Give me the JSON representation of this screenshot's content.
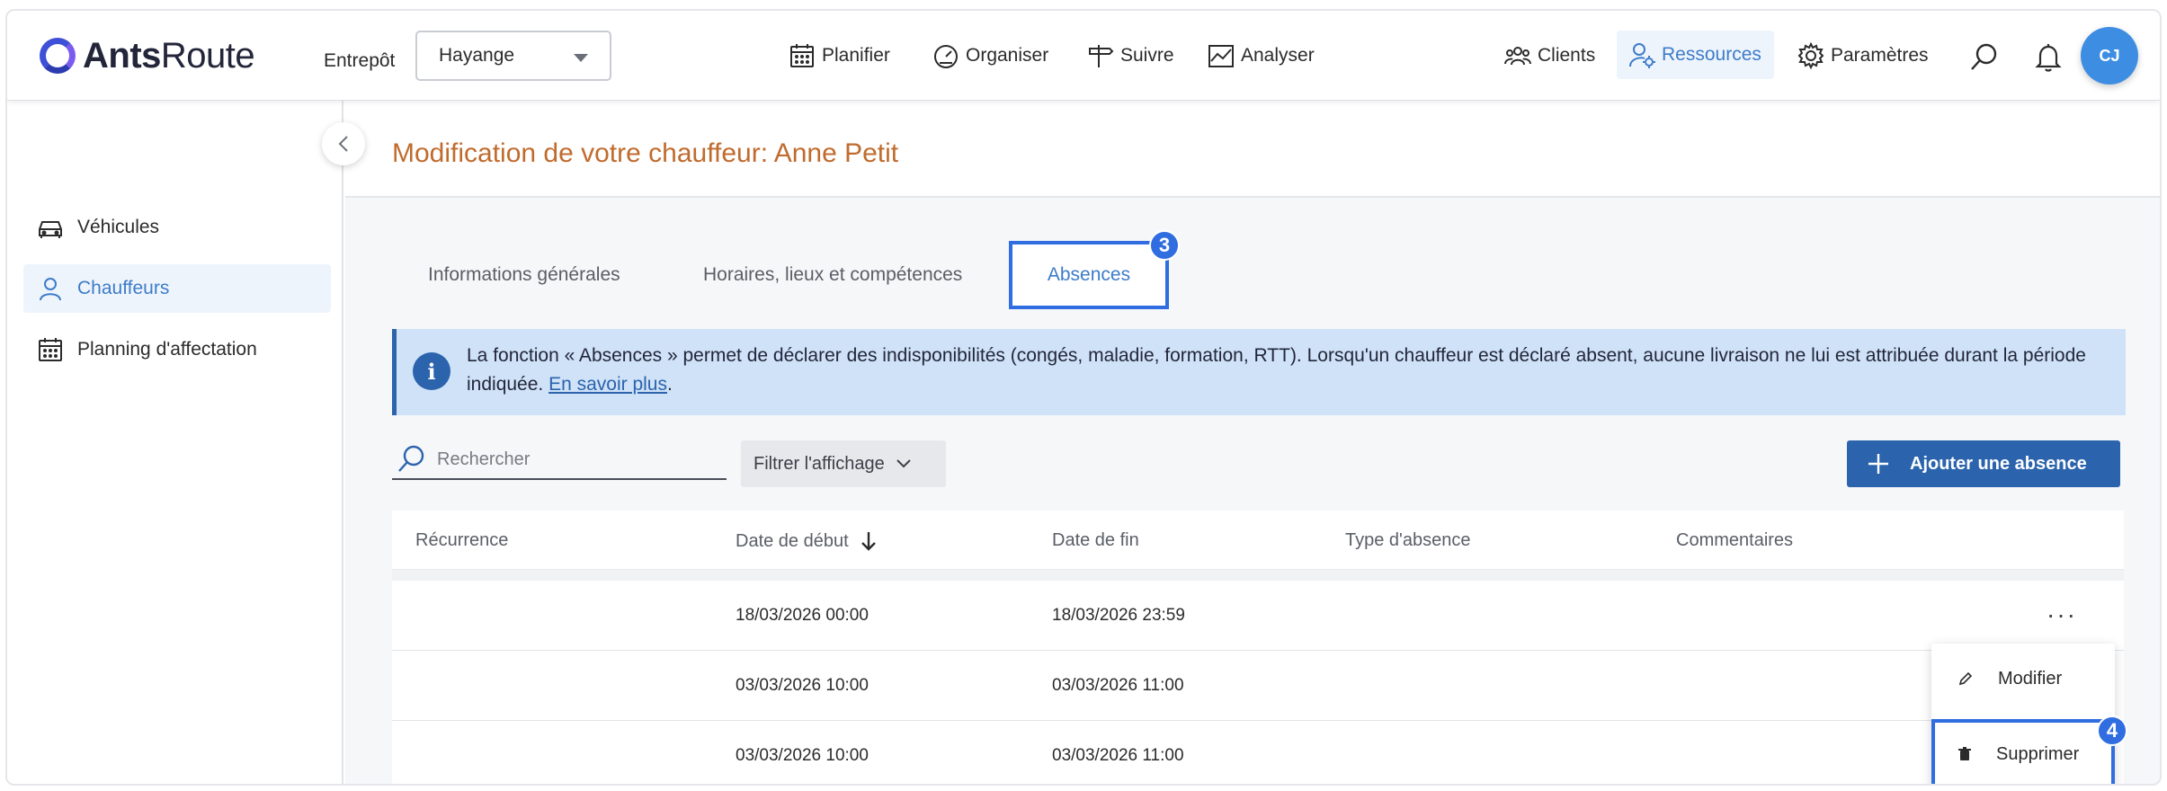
{
  "app": {
    "logo_bold": "Ants",
    "logo_light": "Route"
  },
  "header": {
    "entrepot_label": "Entrepôt",
    "entrepot_value": "Hayange",
    "nav": {
      "planifier": "Planifier",
      "organiser": "Organiser",
      "suivre": "Suivre",
      "analyser": "Analyser",
      "clients": "Clients",
      "ressources": "Ressources",
      "parametres": "Paramètres"
    },
    "avatar_initials": "CJ"
  },
  "sidebar": {
    "items": [
      {
        "label": "Véhicules"
      },
      {
        "label": "Chauffeurs"
      },
      {
        "label": "Planning d'affectation"
      }
    ]
  },
  "page": {
    "title": "Modification de votre chauffeur: Anne Petit"
  },
  "tabs": [
    {
      "label": "Informations générales"
    },
    {
      "label": "Horaires, lieux et compétences"
    },
    {
      "label": "Absences"
    }
  ],
  "step_badges": {
    "tab": "3",
    "delete": "4"
  },
  "info": {
    "icon": "i",
    "text": "La fonction « Absences » permet de déclarer des indisponibilités (congés, maladie, formation, RTT). Lorsqu'un chauffeur est déclaré absent, aucune livraison ne lui est attribuée durant la période indiquée. ",
    "link": "En savoir plus",
    "end": "."
  },
  "toolbar": {
    "search_placeholder": "Rechercher",
    "filter_label": "Filtrer l'affichage",
    "add_label": "Ajouter une absence"
  },
  "table": {
    "columns": [
      "Récurrence",
      "Date de début",
      "Date de fin",
      "Type d'absence",
      "Commentaires"
    ],
    "rows": [
      {
        "recurrence": "",
        "start": "18/03/2026 00:00",
        "end": "18/03/2026 23:59",
        "type": "",
        "comment": ""
      },
      {
        "recurrence": "",
        "start": "03/03/2026 10:00",
        "end": "03/03/2026 11:00",
        "type": "",
        "comment": ""
      },
      {
        "recurrence": "",
        "start": "03/03/2026 10:00",
        "end": "03/03/2026 11:00",
        "type": "",
        "comment": ""
      }
    ],
    "row_menu": "···"
  },
  "row_actions": {
    "edit": "Modifier",
    "delete": "Supprimer"
  },
  "colors": {
    "primary": "#2b63ad",
    "accent_orange": "#c06b2d",
    "highlight": "#2f6de0",
    "info_bg": "#cfe2f7"
  }
}
